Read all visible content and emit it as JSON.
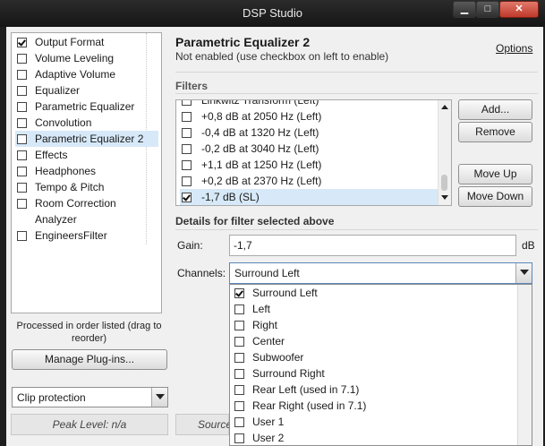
{
  "window": {
    "title": "DSP Studio",
    "minimize": "▁",
    "maximize": "□",
    "close": "✕"
  },
  "nav": {
    "items": [
      {
        "label": "Output Format",
        "checked": true
      },
      {
        "label": "Volume Leveling",
        "checked": false
      },
      {
        "label": "Adaptive Volume",
        "checked": false
      },
      {
        "label": "Equalizer",
        "checked": false
      },
      {
        "label": "Parametric Equalizer",
        "checked": false
      },
      {
        "label": "Convolution",
        "checked": false
      },
      {
        "label": "Parametric Equalizer 2",
        "checked": false,
        "selected": true
      },
      {
        "label": "Effects",
        "checked": false
      },
      {
        "label": "Headphones",
        "checked": false
      },
      {
        "label": "Tempo & Pitch",
        "checked": false
      },
      {
        "label": "Room Correction",
        "checked": false
      },
      {
        "label": "Analyzer",
        "nocheckbox": true
      },
      {
        "label": "EngineersFilter",
        "checked": false
      }
    ],
    "footnote": "Processed in order listed (drag to reorder)",
    "manage_button": "Manage Plug-ins...",
    "clip_select": "Clip protection",
    "peak_level": "Peak Level: n/a",
    "source": "Source"
  },
  "main": {
    "title": "Parametric Equalizer 2",
    "subtitle": "Not enabled (use checkbox on left to enable)",
    "options_link": "Options",
    "filters_heading": "Filters",
    "filters": [
      {
        "label": "Linkwitz Transform (Left)",
        "checked": false
      },
      {
        "label": "+0,8 dB at 2050 Hz (Left)",
        "checked": false
      },
      {
        "label": "-0,4 dB at 1320 Hz (Left)",
        "checked": false
      },
      {
        "label": "-0,2 dB at 3040 Hz (Left)",
        "checked": false
      },
      {
        "label": "+1,1 dB at 1250 Hz (Left)",
        "checked": false
      },
      {
        "label": "+0,2 dB at 2370 Hz (Left)",
        "checked": false
      },
      {
        "label": "-1,7 dB (SL)",
        "checked": true,
        "selected": true
      }
    ],
    "buttons": {
      "add": "Add...",
      "remove": "Remove",
      "move_up": "Move Up",
      "move_down": "Move Down"
    },
    "details_heading": "Details for filter selected above",
    "gain_label": "Gain:",
    "gain_value": "-1,7",
    "gain_unit": "dB",
    "channels_label": "Channels:",
    "channels_selected": "Surround Left",
    "channel_options": [
      {
        "label": "Surround Left",
        "checked": true
      },
      {
        "label": "Left",
        "checked": false
      },
      {
        "label": "Right",
        "checked": false
      },
      {
        "label": "Center",
        "checked": false
      },
      {
        "label": "Subwoofer",
        "checked": false
      },
      {
        "label": "Surround Right",
        "checked": false
      },
      {
        "label": "Rear Left (used in 7.1)",
        "checked": false
      },
      {
        "label": "Rear Right (used in 7.1)",
        "checked": false
      },
      {
        "label": "User 1",
        "checked": false
      },
      {
        "label": "User 2",
        "checked": false
      }
    ]
  }
}
